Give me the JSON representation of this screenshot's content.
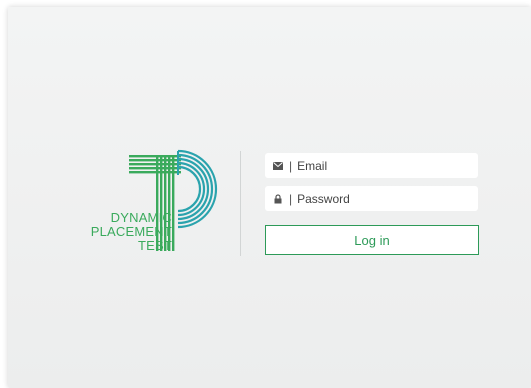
{
  "logo": {
    "line1": "DYNAMIC",
    "line2": "PLACEMENT",
    "line3": "TEST",
    "colors": {
      "green": "#3aaa5c",
      "teal": "#2aa3ad"
    }
  },
  "login": {
    "email_placeholder": "Email",
    "password_placeholder": "Password",
    "separator": "|",
    "button_label": "Log in",
    "email_icon": "envelope-icon",
    "password_icon": "lock-icon"
  },
  "colors": {
    "accent": "#2d9a58",
    "background": "#eeefef"
  }
}
